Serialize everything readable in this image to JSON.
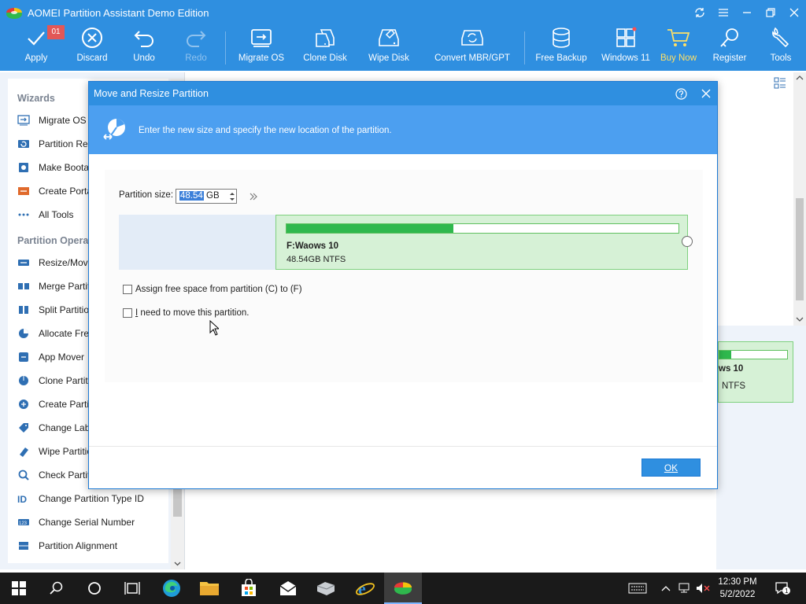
{
  "window": {
    "title": "AOMEI Partition Assistant Demo Edition",
    "badge": "01"
  },
  "toolbar": {
    "apply": "Apply",
    "discard": "Discard",
    "undo": "Undo",
    "redo": "Redo",
    "migrate_os": "Migrate OS",
    "clone_disk": "Clone Disk",
    "wipe_disk": "Wipe Disk",
    "convert": "Convert MBR/GPT",
    "free_backup": "Free Backup",
    "windows11": "Windows 11",
    "buy_now": "Buy Now",
    "register": "Register",
    "tools": "Tools"
  },
  "sidebar": {
    "wizards_title": "Wizards",
    "wizards": [
      {
        "label": "Migrate OS to",
        "icon": "migrate-icon"
      },
      {
        "label": "Partition Rec",
        "icon": "partition-recovery-icon"
      },
      {
        "label": "Make Bootab",
        "icon": "bootable-media-icon"
      },
      {
        "label": "Create Porta",
        "icon": "portable-icon"
      },
      {
        "label": "All Tools",
        "icon": "all-tools-icon"
      }
    ],
    "ops_title": "Partition Operat",
    "operations": [
      {
        "label": "Resize/Move",
        "icon": "resize-icon"
      },
      {
        "label": "Merge Partiti",
        "icon": "merge-icon"
      },
      {
        "label": "Split Partition",
        "icon": "split-icon"
      },
      {
        "label": "Allocate Free",
        "icon": "allocate-icon"
      },
      {
        "label": "App Mover",
        "icon": "app-mover-icon"
      },
      {
        "label": "Clone Partitio",
        "icon": "clone-icon"
      },
      {
        "label": "Create Partiti",
        "icon": "create-icon"
      },
      {
        "label": "Change Labe",
        "icon": "label-icon"
      },
      {
        "label": "Wipe Partition",
        "icon": "wipe-icon"
      },
      {
        "label": "Check Partitio",
        "icon": "check-icon"
      },
      {
        "label": "Change Partition Type ID",
        "icon": "type-id-icon"
      },
      {
        "label": "Change Serial Number",
        "icon": "serial-icon"
      },
      {
        "label": "Partition Alignment",
        "icon": "alignment-icon"
      }
    ]
  },
  "background_partition": {
    "name": "ws 10",
    "fs": "NTFS",
    "used_fraction": 0.17
  },
  "dialog": {
    "title": "Move and Resize Partition",
    "banner_text": "Enter the new size and specify the new location of the partition.",
    "size_label": "Partition size:",
    "size_value": "48.54",
    "size_unit": "GB",
    "partition": {
      "name": "F:Waows 10",
      "info": "48.54GB NTFS",
      "used_fraction": 0.426
    },
    "checkbox_assign": "Assign free space from partition (C) to (F)",
    "checkbox_move_prefix": "I",
    "checkbox_move_rest": " need to move this partition.",
    "ok": "OK"
  },
  "taskbar": {
    "time": "12:30 PM",
    "date": "5/2/2022",
    "notifications": "1"
  },
  "colors": {
    "accent": "#2f8fe0",
    "banner": "#4c9ff0",
    "partition_fill": "#2fb84d",
    "partition_bg": "#d6f1d6",
    "buy_now": "#ffe066"
  }
}
